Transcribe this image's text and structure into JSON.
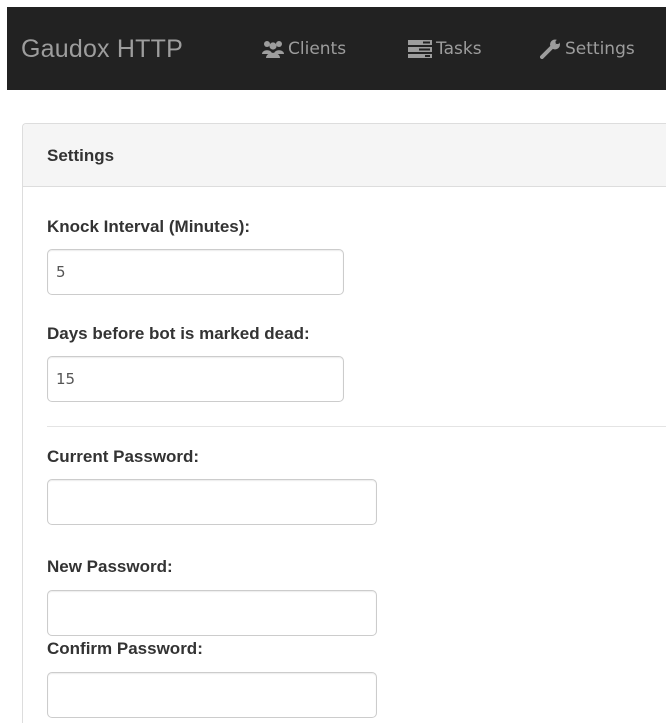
{
  "navbar": {
    "brand": "Gaudox HTTP",
    "items": [
      {
        "label": "Clients",
        "icon": "users-icon"
      },
      {
        "label": "Tasks",
        "icon": "tasks-icon"
      },
      {
        "label": "Settings",
        "icon": "wrench-icon"
      }
    ],
    "background": "#222222",
    "text_color": "#9d9d9d"
  },
  "panel": {
    "title": "Settings"
  },
  "form": {
    "knock_interval_label": "Knock Interval (Minutes):",
    "knock_interval_value": "5",
    "days_dead_label": "Days before bot is marked dead:",
    "days_dead_value": "15",
    "current_password_label": "Current Password:",
    "current_password_value": "",
    "new_password_label": "New Password:",
    "new_password_value": "",
    "confirm_password_label": "Confirm Password:",
    "confirm_password_value": ""
  }
}
